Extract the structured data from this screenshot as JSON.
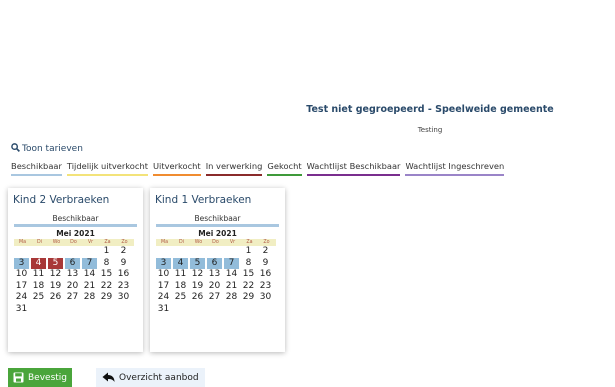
{
  "header": {
    "title": "Test niet gegroepeerd - Speelweide gemeente",
    "subtitle": "Testing"
  },
  "toon_tarieven": {
    "label": "Toon tarieven",
    "icon": "search-icon"
  },
  "legend": [
    {
      "label": "Beschikbaar",
      "color": "#a9c7e0"
    },
    {
      "label": "Tijdelijk uitverkocht",
      "color": "#f3e37a"
    },
    {
      "label": "Uitverkocht",
      "color": "#f08c30"
    },
    {
      "label": "In verwerking",
      "color": "#8a2b2b"
    },
    {
      "label": "Gekocht",
      "color": "#3f9a3a"
    },
    {
      "label": "Wachtlijst Beschikbaar",
      "color": "#7a2e8e"
    },
    {
      "label": "Wachtlijst Ingeschreven",
      "color": "#9a84c8"
    }
  ],
  "colors": {
    "available": "#92bcda",
    "sold": "#a83838",
    "dow_bg": "#f1eec3",
    "confirm": "#4aa53b"
  },
  "cards": [
    {
      "title": "Kind 2 Verbraeken",
      "status": "Beschikbaar",
      "month": "Mei 2021",
      "dow": [
        "Ma",
        "Di",
        "Wo",
        "Do",
        "Vr",
        "Za",
        "Zo"
      ],
      "weeks": [
        [
          null,
          null,
          null,
          null,
          null,
          "1",
          "2"
        ],
        [
          "3",
          "4",
          "5",
          "6",
          "7",
          "8",
          "9"
        ],
        [
          "10",
          "11",
          "12",
          "13",
          "14",
          "15",
          "16"
        ],
        [
          "17",
          "18",
          "19",
          "20",
          "21",
          "22",
          "23"
        ],
        [
          "24",
          "25",
          "26",
          "27",
          "28",
          "29",
          "30"
        ],
        [
          "31",
          null,
          null,
          null,
          null,
          null,
          null
        ]
      ],
      "available_days": [
        "3",
        "6",
        "7"
      ],
      "sold_days": [
        "4",
        "5"
      ]
    },
    {
      "title": "Kind 1 Verbraeken",
      "status": "Beschikbaar",
      "month": "Mei 2021",
      "dow": [
        "Ma",
        "Di",
        "Wo",
        "Do",
        "Vr",
        "Za",
        "Zo"
      ],
      "weeks": [
        [
          null,
          null,
          null,
          null,
          null,
          "1",
          "2"
        ],
        [
          "3",
          "4",
          "5",
          "6",
          "7",
          "8",
          "9"
        ],
        [
          "10",
          "11",
          "12",
          "13",
          "14",
          "15",
          "16"
        ],
        [
          "17",
          "18",
          "19",
          "20",
          "21",
          "22",
          "23"
        ],
        [
          "24",
          "25",
          "26",
          "27",
          "28",
          "29",
          "30"
        ],
        [
          "31",
          null,
          null,
          null,
          null,
          null,
          null
        ]
      ],
      "available_days": [
        "3",
        "4",
        "5",
        "6",
        "7"
      ],
      "sold_days": []
    }
  ],
  "buttons": {
    "bevestig": "Bevestig",
    "overzicht": "Overzicht aanbod"
  }
}
